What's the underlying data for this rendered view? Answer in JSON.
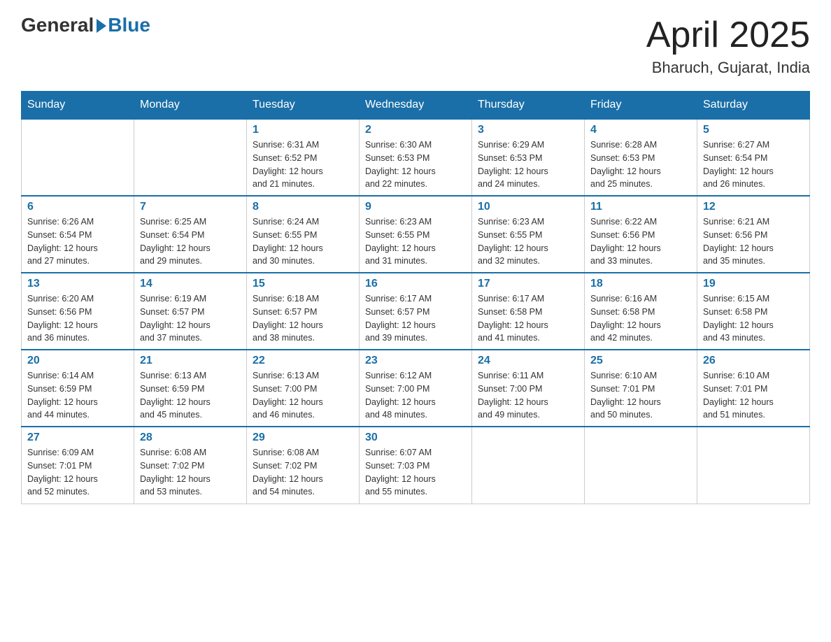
{
  "header": {
    "logo_general": "General",
    "logo_blue": "Blue",
    "title": "April 2025",
    "location": "Bharuch, Gujarat, India"
  },
  "calendar": {
    "days_of_week": [
      "Sunday",
      "Monday",
      "Tuesday",
      "Wednesday",
      "Thursday",
      "Friday",
      "Saturday"
    ],
    "weeks": [
      [
        {
          "day": "",
          "info": ""
        },
        {
          "day": "",
          "info": ""
        },
        {
          "day": "1",
          "info": "Sunrise: 6:31 AM\nSunset: 6:52 PM\nDaylight: 12 hours\nand 21 minutes."
        },
        {
          "day": "2",
          "info": "Sunrise: 6:30 AM\nSunset: 6:53 PM\nDaylight: 12 hours\nand 22 minutes."
        },
        {
          "day": "3",
          "info": "Sunrise: 6:29 AM\nSunset: 6:53 PM\nDaylight: 12 hours\nand 24 minutes."
        },
        {
          "day": "4",
          "info": "Sunrise: 6:28 AM\nSunset: 6:53 PM\nDaylight: 12 hours\nand 25 minutes."
        },
        {
          "day": "5",
          "info": "Sunrise: 6:27 AM\nSunset: 6:54 PM\nDaylight: 12 hours\nand 26 minutes."
        }
      ],
      [
        {
          "day": "6",
          "info": "Sunrise: 6:26 AM\nSunset: 6:54 PM\nDaylight: 12 hours\nand 27 minutes."
        },
        {
          "day": "7",
          "info": "Sunrise: 6:25 AM\nSunset: 6:54 PM\nDaylight: 12 hours\nand 29 minutes."
        },
        {
          "day": "8",
          "info": "Sunrise: 6:24 AM\nSunset: 6:55 PM\nDaylight: 12 hours\nand 30 minutes."
        },
        {
          "day": "9",
          "info": "Sunrise: 6:23 AM\nSunset: 6:55 PM\nDaylight: 12 hours\nand 31 minutes."
        },
        {
          "day": "10",
          "info": "Sunrise: 6:23 AM\nSunset: 6:55 PM\nDaylight: 12 hours\nand 32 minutes."
        },
        {
          "day": "11",
          "info": "Sunrise: 6:22 AM\nSunset: 6:56 PM\nDaylight: 12 hours\nand 33 minutes."
        },
        {
          "day": "12",
          "info": "Sunrise: 6:21 AM\nSunset: 6:56 PM\nDaylight: 12 hours\nand 35 minutes."
        }
      ],
      [
        {
          "day": "13",
          "info": "Sunrise: 6:20 AM\nSunset: 6:56 PM\nDaylight: 12 hours\nand 36 minutes."
        },
        {
          "day": "14",
          "info": "Sunrise: 6:19 AM\nSunset: 6:57 PM\nDaylight: 12 hours\nand 37 minutes."
        },
        {
          "day": "15",
          "info": "Sunrise: 6:18 AM\nSunset: 6:57 PM\nDaylight: 12 hours\nand 38 minutes."
        },
        {
          "day": "16",
          "info": "Sunrise: 6:17 AM\nSunset: 6:57 PM\nDaylight: 12 hours\nand 39 minutes."
        },
        {
          "day": "17",
          "info": "Sunrise: 6:17 AM\nSunset: 6:58 PM\nDaylight: 12 hours\nand 41 minutes."
        },
        {
          "day": "18",
          "info": "Sunrise: 6:16 AM\nSunset: 6:58 PM\nDaylight: 12 hours\nand 42 minutes."
        },
        {
          "day": "19",
          "info": "Sunrise: 6:15 AM\nSunset: 6:58 PM\nDaylight: 12 hours\nand 43 minutes."
        }
      ],
      [
        {
          "day": "20",
          "info": "Sunrise: 6:14 AM\nSunset: 6:59 PM\nDaylight: 12 hours\nand 44 minutes."
        },
        {
          "day": "21",
          "info": "Sunrise: 6:13 AM\nSunset: 6:59 PM\nDaylight: 12 hours\nand 45 minutes."
        },
        {
          "day": "22",
          "info": "Sunrise: 6:13 AM\nSunset: 7:00 PM\nDaylight: 12 hours\nand 46 minutes."
        },
        {
          "day": "23",
          "info": "Sunrise: 6:12 AM\nSunset: 7:00 PM\nDaylight: 12 hours\nand 48 minutes."
        },
        {
          "day": "24",
          "info": "Sunrise: 6:11 AM\nSunset: 7:00 PM\nDaylight: 12 hours\nand 49 minutes."
        },
        {
          "day": "25",
          "info": "Sunrise: 6:10 AM\nSunset: 7:01 PM\nDaylight: 12 hours\nand 50 minutes."
        },
        {
          "day": "26",
          "info": "Sunrise: 6:10 AM\nSunset: 7:01 PM\nDaylight: 12 hours\nand 51 minutes."
        }
      ],
      [
        {
          "day": "27",
          "info": "Sunrise: 6:09 AM\nSunset: 7:01 PM\nDaylight: 12 hours\nand 52 minutes."
        },
        {
          "day": "28",
          "info": "Sunrise: 6:08 AM\nSunset: 7:02 PM\nDaylight: 12 hours\nand 53 minutes."
        },
        {
          "day": "29",
          "info": "Sunrise: 6:08 AM\nSunset: 7:02 PM\nDaylight: 12 hours\nand 54 minutes."
        },
        {
          "day": "30",
          "info": "Sunrise: 6:07 AM\nSunset: 7:03 PM\nDaylight: 12 hours\nand 55 minutes."
        },
        {
          "day": "",
          "info": ""
        },
        {
          "day": "",
          "info": ""
        },
        {
          "day": "",
          "info": ""
        }
      ]
    ]
  }
}
